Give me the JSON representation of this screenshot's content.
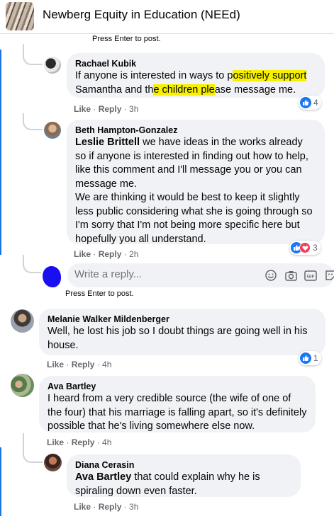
{
  "header": {
    "title": "Newberg Equity in Education (NEEd)"
  },
  "hints": {
    "top": "Press Enter to post.",
    "reply": "Press Enter to post."
  },
  "comments": [
    {
      "author": "Rachael Kubik",
      "text_parts": [
        "If anyone is interested in ways to p",
        "ositively support",
        "Samantha and th",
        "e children ple",
        "ase message me."
      ],
      "actions": {
        "like": "Like",
        "reply": "Reply",
        "time": "3h"
      },
      "reactions": {
        "count": "4"
      }
    },
    {
      "author": "Beth Hampton-Gonzalez",
      "mention": "Leslie Brittell",
      "text_line1": "we have ideas in the works already so",
      "text_rest": "if anyone is interested in finding out how to help, like this comment and I'll message you or you can message me.",
      "text_line2": "We are thinking it would be best to keep it slightly less public considering what she is going through so I'm sorry that I'm not being more specific here but hopefully you all understand.",
      "actions": {
        "like": "Like",
        "reply": "Reply",
        "time": "2h"
      },
      "reactions": {
        "count": "3"
      }
    },
    {
      "author": "Melanie Walker Mildenberger",
      "text": "Well, he lost his job so I doubt things are going well in his house.",
      "actions": {
        "like": "Like",
        "reply": "Reply",
        "time": "4h"
      },
      "reactions": {
        "count": "1"
      }
    },
    {
      "author": "Ava Bartley",
      "text": "I heard from a very credible source (the wife of one of the four) that his marriage is falling apart, so it's definitely possible that he's living somewhere else now.",
      "actions": {
        "like": "Like",
        "reply": "Reply",
        "time": "4h"
      }
    },
    {
      "author": "Diana Cerasin",
      "mention": "Ava Bartley",
      "text": "that could explain why he is spiraling down even faster.",
      "actions": {
        "like": "Like",
        "reply": "Reply",
        "time": "3h"
      }
    }
  ],
  "reply_box": {
    "placeholder": "Write a reply...",
    "tools": [
      "emoji-icon",
      "camera-icon",
      "gif-icon",
      "sticker-icon"
    ]
  },
  "colors": {
    "accent": "#1b74e4",
    "highlight": "#f7f000",
    "bubble": "#f0f2f5",
    "meta": "#65676b"
  }
}
